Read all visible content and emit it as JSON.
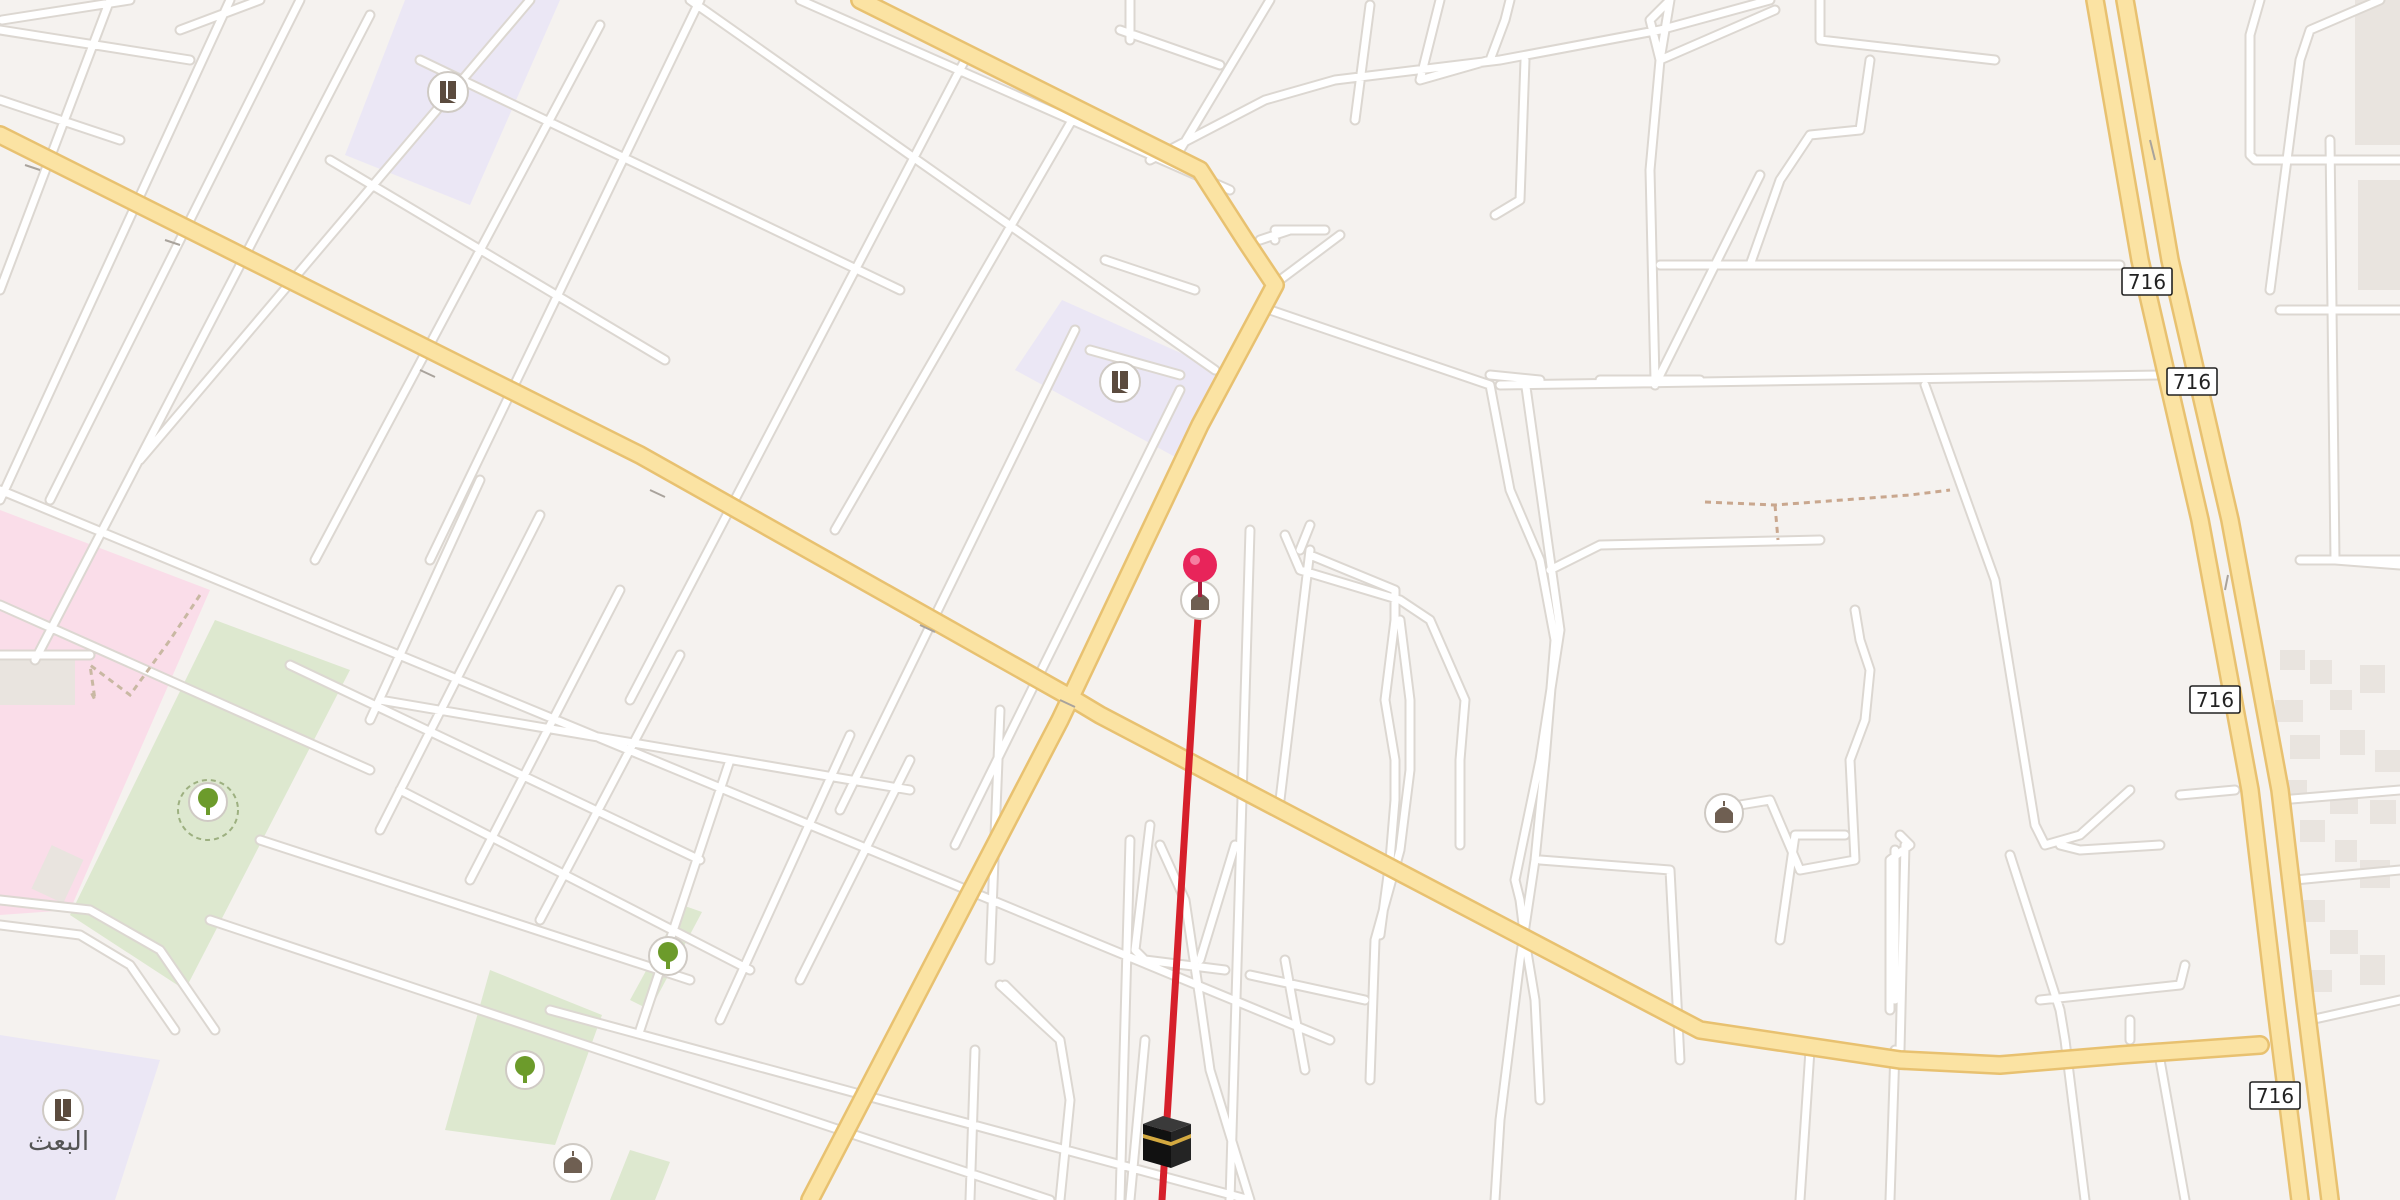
{
  "map": {
    "route_shields": [
      "716",
      "716",
      "716",
      "716"
    ],
    "place_labels": [
      "البعث"
    ],
    "colors": {
      "background": "#f5f2ef",
      "minor_road": "#ffffff",
      "minor_road_casing": "#dcd7d1",
      "major_road": "#fbe3a3",
      "major_road_casing": "#e8c170",
      "education_area": "#ebe7f5",
      "park_area": "#dde8cf",
      "hospital_area": "#fadde9",
      "route_line": "#d6202b",
      "pin": "#e8245a"
    },
    "pois": [
      {
        "icon": "school-icon"
      },
      {
        "icon": "school-icon"
      },
      {
        "icon": "school-icon"
      },
      {
        "icon": "park-tree-icon"
      },
      {
        "icon": "park-tree-icon"
      },
      {
        "icon": "park-tree-icon"
      },
      {
        "icon": "mosque-icon"
      },
      {
        "icon": "mosque-icon"
      },
      {
        "icon": "mosque-icon"
      },
      {
        "icon": "kaaba-icon"
      }
    ],
    "markers": [
      {
        "icon": "map-pin-icon"
      }
    ]
  }
}
